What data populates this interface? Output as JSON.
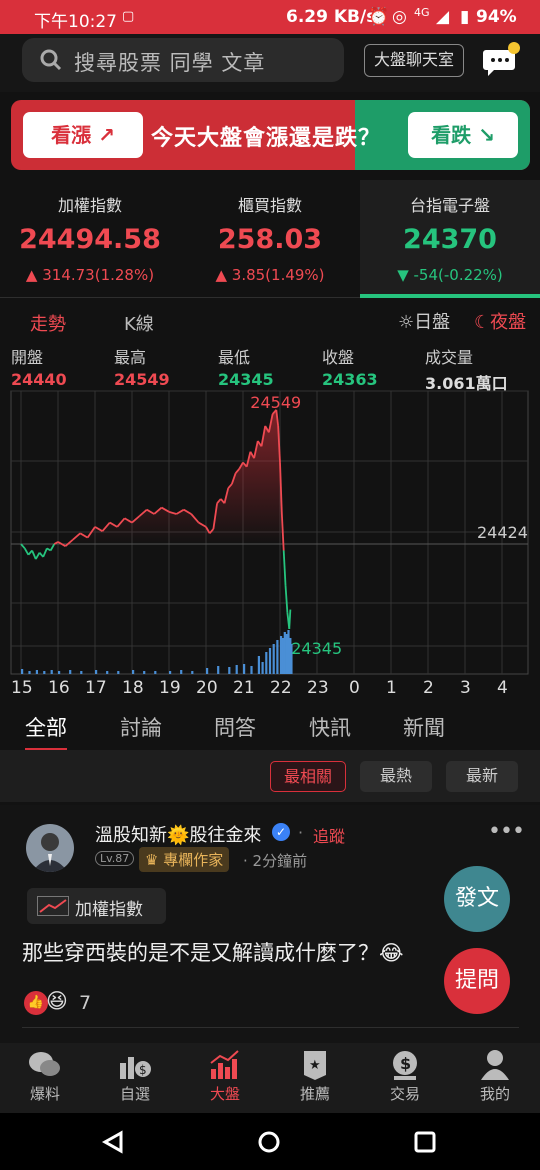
{
  "status": {
    "time": "下午10:27",
    "net": "6.29 KB/s",
    "signal": "4G",
    "battery": "94%"
  },
  "search": {
    "placeholder": "搜尋股票 同學 文章"
  },
  "topbar": {
    "chatroom": "大盤聊天室"
  },
  "vote": {
    "bull": "看漲",
    "question": "今天大盤會漲還是跌？",
    "bear": "看跌"
  },
  "indices": [
    {
      "name": "加權指數",
      "value": "24494.58",
      "change": "▲ 314.73(1.28%)",
      "trend": "up"
    },
    {
      "name": "櫃買指數",
      "value": "258.03",
      "change": "▲ 3.85(1.49%)",
      "trend": "up"
    },
    {
      "name": "台指電子盤",
      "value": "24370",
      "change": "▼ -54(-0.22%)",
      "trend": "down"
    }
  ],
  "chart_tabs": {
    "trend": "走勢",
    "kline": "K線",
    "day": "日盤",
    "night": "夜盤"
  },
  "ohlc": [
    {
      "label": "開盤",
      "value": "24440",
      "color": "#ef4a52"
    },
    {
      "label": "最高",
      "value": "24549",
      "color": "#ef4a52"
    },
    {
      "label": "最低",
      "value": "24345",
      "color": "#26c47e"
    },
    {
      "label": "收盤",
      "value": "24363",
      "color": "#26c47e"
    },
    {
      "label": "成交量",
      "value": "3.061萬口",
      "color": "#dddddd"
    }
  ],
  "chart_data": {
    "type": "line",
    "x_ticks": [
      "15",
      "16",
      "17",
      "18",
      "19",
      "20",
      "21",
      "22",
      "23",
      "0",
      "1",
      "2",
      "3",
      "4"
    ],
    "reference": 24424,
    "high_label": "24549",
    "low_label": "24345",
    "ref_label": "24424",
    "ylim": [
      24330,
      24560
    ],
    "prices": [
      [
        15.0,
        24424
      ],
      [
        15.1,
        24420
      ],
      [
        15.2,
        24414
      ],
      [
        15.3,
        24418
      ],
      [
        15.4,
        24410
      ],
      [
        15.5,
        24416
      ],
      [
        15.6,
        24412
      ],
      [
        15.7,
        24420
      ],
      [
        15.8,
        24418
      ],
      [
        15.9,
        24424
      ],
      [
        16.0,
        24426
      ],
      [
        16.2,
        24422
      ],
      [
        16.4,
        24428
      ],
      [
        16.6,
        24434
      ],
      [
        16.8,
        24430
      ],
      [
        17.0,
        24440
      ],
      [
        17.2,
        24436
      ],
      [
        17.4,
        24444
      ],
      [
        17.6,
        24440
      ],
      [
        17.8,
        24448
      ],
      [
        18.0,
        24444
      ],
      [
        18.2,
        24450
      ],
      [
        18.4,
        24456
      ],
      [
        18.6,
        24452
      ],
      [
        18.8,
        24458
      ],
      [
        19.0,
        24454
      ],
      [
        19.2,
        24452
      ],
      [
        19.4,
        24456
      ],
      [
        19.6,
        24452
      ],
      [
        19.8,
        24444
      ],
      [
        20.0,
        24440
      ],
      [
        20.1,
        24434
      ],
      [
        20.2,
        24438
      ],
      [
        20.3,
        24462
      ],
      [
        20.4,
        24466
      ],
      [
        20.5,
        24462
      ],
      [
        20.6,
        24476
      ],
      [
        20.7,
        24480
      ],
      [
        20.8,
        24490
      ],
      [
        20.9,
        24494
      ],
      [
        21.0,
        24500
      ],
      [
        21.1,
        24496
      ],
      [
        21.2,
        24510
      ],
      [
        21.3,
        24504
      ],
      [
        21.4,
        24520
      ],
      [
        21.5,
        24515
      ],
      [
        21.6,
        24534
      ],
      [
        21.7,
        24528
      ],
      [
        21.8,
        24545
      ],
      [
        21.9,
        24549
      ],
      [
        21.95,
        24534
      ],
      [
        22.0,
        24500
      ],
      [
        22.05,
        24452
      ],
      [
        22.1,
        24418
      ],
      [
        22.15,
        24385
      ],
      [
        22.2,
        24360
      ],
      [
        22.25,
        24345
      ],
      [
        22.28,
        24363
      ]
    ],
    "volume": [
      [
        15.0,
        5
      ],
      [
        15.2,
        3
      ],
      [
        15.4,
        4
      ],
      [
        15.6,
        3
      ],
      [
        15.8,
        4
      ],
      [
        16.0,
        3
      ],
      [
        16.3,
        4
      ],
      [
        16.6,
        3
      ],
      [
        17.0,
        4
      ],
      [
        17.3,
        3
      ],
      [
        17.6,
        3
      ],
      [
        18.0,
        4
      ],
      [
        18.3,
        3
      ],
      [
        18.6,
        3
      ],
      [
        19.0,
        3
      ],
      [
        19.3,
        4
      ],
      [
        19.6,
        3
      ],
      [
        20.0,
        6
      ],
      [
        20.3,
        8
      ],
      [
        20.6,
        7
      ],
      [
        20.8,
        9
      ],
      [
        21.0,
        10
      ],
      [
        21.2,
        8
      ],
      [
        21.4,
        18
      ],
      [
        21.5,
        12
      ],
      [
        21.6,
        22
      ],
      [
        21.7,
        26
      ],
      [
        21.8,
        30
      ],
      [
        21.9,
        34
      ],
      [
        22.0,
        38
      ],
      [
        22.05,
        36
      ],
      [
        22.1,
        42
      ],
      [
        22.15,
        40
      ],
      [
        22.2,
        44
      ],
      [
        22.25,
        36
      ],
      [
        22.28,
        30
      ]
    ]
  },
  "feed_tabs": [
    "全部",
    "討論",
    "問答",
    "快訊",
    "新聞"
  ],
  "filters": [
    "最相關",
    "最熱",
    "最新"
  ],
  "post": {
    "author": "溫股知新🌞股往金來",
    "follow": "追蹤",
    "level": "Lv.87",
    "badge": "專欄作家",
    "time": "2分鐘前",
    "tag": "加權指數",
    "content": "那些穿西裝的是不是又解讀成什麼了？😂",
    "reactions": "7"
  },
  "fab": {
    "post": "發文",
    "ask": "提問"
  },
  "nav": [
    "爆料",
    "自選",
    "大盤",
    "推薦",
    "交易",
    "我的"
  ]
}
